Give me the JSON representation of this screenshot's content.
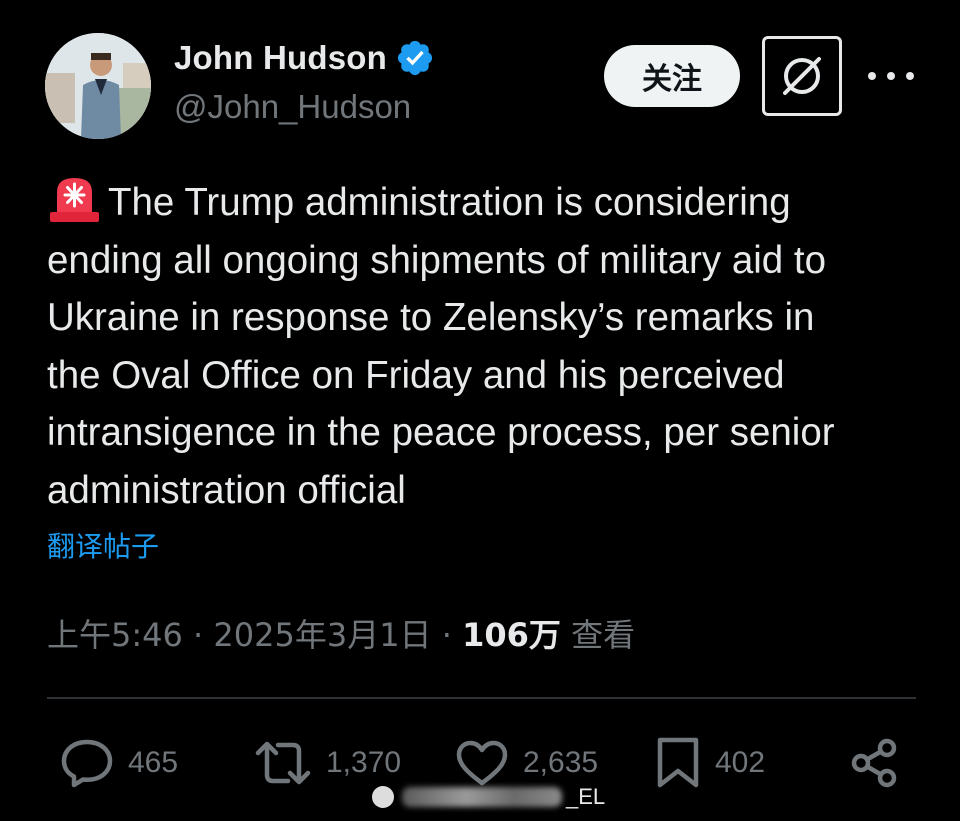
{
  "author": {
    "display_name": "John Hudson",
    "handle": "@John_Hudson",
    "verified": true
  },
  "header": {
    "follow_label": "关注",
    "grok_icon": "grok-icon",
    "more_icon": "more-icon"
  },
  "tweet": {
    "emoji": "siren-icon",
    "text": "The Trump administration is considering\nending all ongoing shipments of military aid to\nUkraine in response to Zelensky’s remarks in\nthe Oval Office on Friday and his perceived\nintransigence in the peace process, per senior\nadministration official",
    "translate_label": "翻译帖子"
  },
  "meta": {
    "time": "上午5:46",
    "separator": " · ",
    "date": "2025年3月1日",
    "separator2": " · ",
    "views": "106万",
    "views_label": " 查看"
  },
  "actions": {
    "replies": "465",
    "reposts": "1,370",
    "likes": "2,635",
    "bookmarks": "402"
  },
  "watermark": {
    "text": "_EL"
  },
  "colors": {
    "background": "#000000",
    "text": "#e7e9ea",
    "muted": "#71767b",
    "link": "#1d9bf0",
    "verified": "#1d9bf0",
    "divider": "#2f3336"
  }
}
